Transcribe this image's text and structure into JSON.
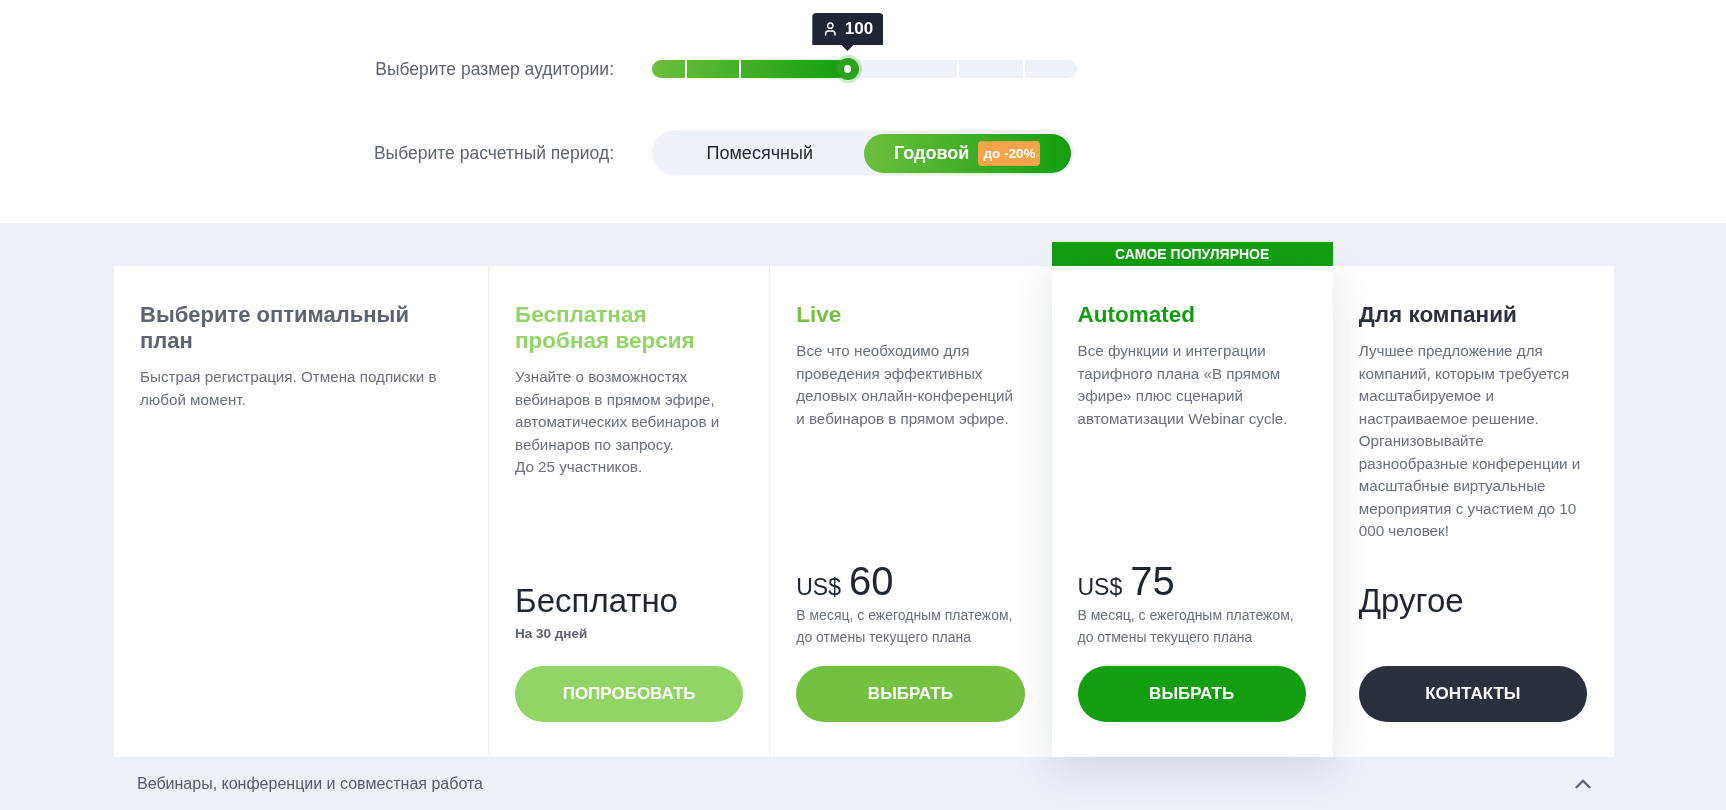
{
  "audience": {
    "label": "Выберите размер аудитории:",
    "value": "100",
    "level": 0.46
  },
  "billing": {
    "label": "Выберите расчетный период:",
    "options": [
      {
        "label": "Помесячный",
        "selected": false
      },
      {
        "label": "Годовой",
        "selected": true,
        "badge": "до -20%"
      }
    ]
  },
  "intro": {
    "title": "Выберите оптимальный план",
    "description": "Быстрая регистрация. Отмена подписки в любой момент."
  },
  "plans": [
    {
      "name": "Бесплатная пробная версия",
      "color": "#92d566",
      "featured": false,
      "description": "Узнайте о возможностях вебинаров в прямом эфире, автоматических вебинаров и вебинаров по запросу.\nДо 25 участников.",
      "price": {
        "kind": "text",
        "value": "Бесплатно",
        "note": "На 30 дней"
      },
      "button": "ПОПРОБОВАТЬ"
    },
    {
      "name": "Live",
      "color": "#74c040",
      "featured": false,
      "description": "Все что необходимо для проведения эффективных деловых онлайн-конференций и вебинаров в прямом эфире.",
      "price": {
        "kind": "amount",
        "currency": "US$",
        "value": "60",
        "note": "В месяц, с ежегодным платежом, до отмены текущего плана"
      },
      "button": "ВЫБРАТЬ"
    },
    {
      "name": "Automated",
      "color": "#139e0f",
      "featured": true,
      "ribbon": "САМОЕ ПОПУЛЯРНОЕ",
      "description": "Все функции и интеграции тарифного плана «В прямом эфире» плюс сценарий автоматизации Webinar cycle.",
      "price": {
        "kind": "amount",
        "currency": "US$",
        "value": "75",
        "note": "В месяц, с ежегодным платежом, до отмены текущего плана"
      },
      "button": "ВЫБРАТЬ"
    },
    {
      "name": "Для компаний",
      "color": "#2b303d",
      "featured": false,
      "description": "Лучшее предложение для компаний, которым требуется масштабируемое и настраиваемое решение. Организовывайте разнообразные конференции и масштабные виртуальные мероприятия с участием до 10 000 человек!",
      "price": {
        "kind": "text",
        "value": "Другое"
      },
      "button": "КОНТАКТЫ"
    }
  ],
  "section": {
    "title": "Вебинары, конференции и совместная работа",
    "expanded": true
  }
}
